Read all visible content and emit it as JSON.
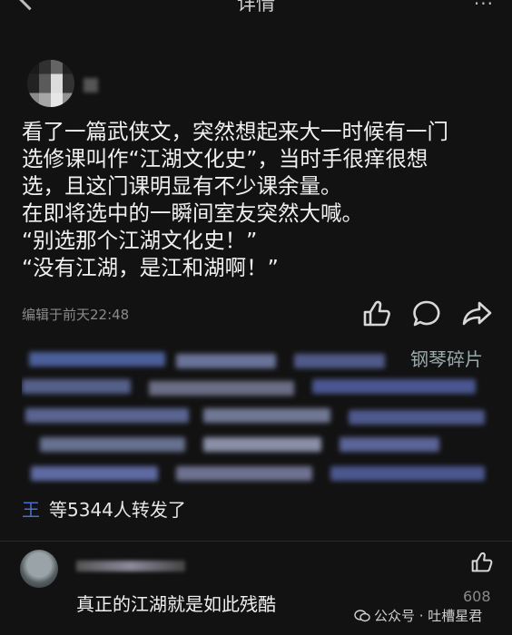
{
  "header": {
    "title": "详情",
    "more": "···"
  },
  "post": {
    "lines": [
      "看了一篇武侠文，突然想起来大一时候有一门",
      "选修课叫作“江湖文化史”，当时手很痒很想",
      "选，且这门课明显有不少课余量。",
      "在即将选中的一瞬间室友突然大喊。",
      "“别选那个江湖文化史！”",
      "“没有江湖，是江和湖啊！”"
    ],
    "edit_time": "编辑于前天22:48"
  },
  "actions": {
    "like": "like-icon",
    "comment": "comment-icon",
    "share": "share-icon"
  },
  "blurred": {
    "fragment1": "钢琴碎片"
  },
  "repost": {
    "name": "王",
    "text": "等5344人转发了"
  },
  "comment": {
    "text": "真正的江湖就是如此残酷",
    "likes": "608"
  },
  "watermark": {
    "text": "公众号 · 吐槽星君"
  }
}
